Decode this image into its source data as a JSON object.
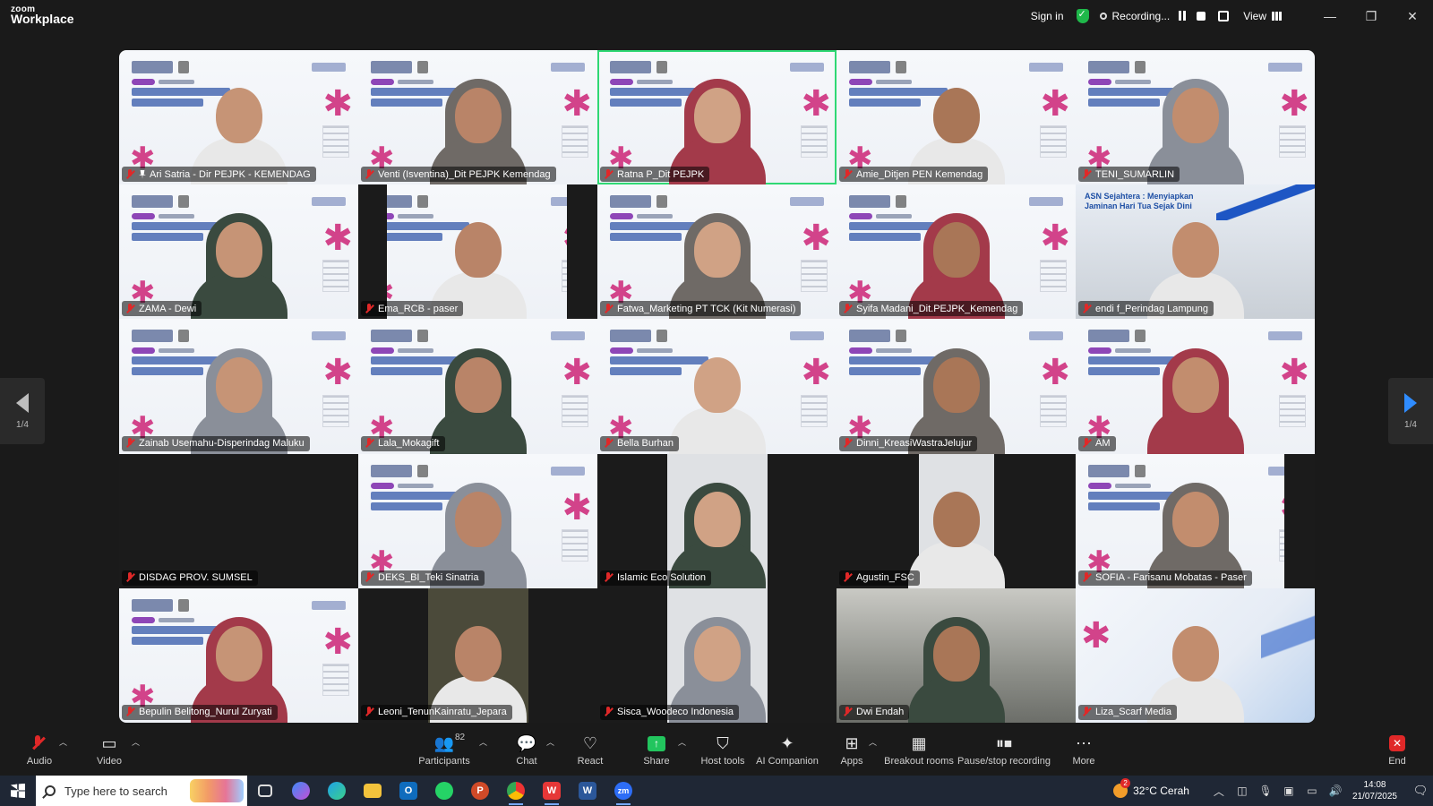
{
  "app": {
    "logo_line1": "zoom",
    "logo_line2": "Workplace"
  },
  "titlebar": {
    "sign_in": "Sign in",
    "recording_label": "Recording...",
    "view_label": "View",
    "window_controls": {
      "minimize": "—",
      "restore": "❐",
      "close": "✕"
    }
  },
  "pager": {
    "left_page": "1/4",
    "right_page": "1/4"
  },
  "participants": [
    {
      "name": "Ari Satria - Dir PEJPK - KEMENDAG",
      "bg": "banner",
      "pinned": true
    },
    {
      "name": "Venti (Isventina)_Dit PEJPK Kemendag",
      "bg": "banner"
    },
    {
      "name": "Ratna P_Dit PEJPK",
      "bg": "banner",
      "active": true
    },
    {
      "name": "Amie_Ditjen PEN Kemendag",
      "bg": "banner"
    },
    {
      "name": "TENI_SUMARLIN",
      "bg": "banner"
    },
    {
      "name": "ZAMA - Dewi",
      "bg": "banner"
    },
    {
      "name": "Ema_RCB - paser",
      "bg": "banner-letterbox"
    },
    {
      "name": "Fatwa_Marketing PT TCK (Kit Numerasi)",
      "bg": "banner"
    },
    {
      "name": "Syifa Madani_Dit.PEJPK_Kemendag",
      "bg": "banner"
    },
    {
      "name": "endi f_Perindag Lampung",
      "bg": "bkd",
      "banner_text": "ASN Sejahtera : Menyiapkan Jaminan Hari Tua Sejak Dini"
    },
    {
      "name": "Zainab Usemahu-Disperindag Maluku",
      "bg": "banner"
    },
    {
      "name": "Lala_Mokagift",
      "bg": "banner"
    },
    {
      "name": "Bella Burhan",
      "bg": "banner"
    },
    {
      "name": "Dinni_KreasiWastraJelujur",
      "bg": "banner"
    },
    {
      "name": "AM",
      "bg": "banner"
    },
    {
      "name": "DISDAG PROV. SUMSEL",
      "bg": "dark"
    },
    {
      "name": "DEKS_BI_Teki Sinatria",
      "bg": "banner"
    },
    {
      "name": "Islamic Eco Solution",
      "bg": "portrait"
    },
    {
      "name": "Agustin_FSC",
      "bg": "portrait-small"
    },
    {
      "name": "SOFIA - Farisanu Mobatas - Paser",
      "bg": "banner-letterbox-right"
    },
    {
      "name": "Bepulin Belitong_Nurul Zuryati",
      "bg": "banner"
    },
    {
      "name": "Leoni_TenunKainratu_Jepara",
      "bg": "portrait-green"
    },
    {
      "name": "Sisca_Woodeco Indonesia",
      "bg": "portrait"
    },
    {
      "name": "Dwi Endah",
      "bg": "room"
    },
    {
      "name": "Liza_Scarf Media",
      "bg": "blue"
    }
  ],
  "toolbar": {
    "audio": "Audio",
    "video": "Video",
    "participants": "Participants",
    "participants_count": "82",
    "chat": "Chat",
    "react": "React",
    "share": "Share",
    "host_tools": "Host tools",
    "ai_companion": "AI Companion",
    "apps": "Apps",
    "breakout_rooms": "Breakout rooms",
    "pause_stop_recording": "Pause/stop recording",
    "more": "More",
    "end": "End"
  },
  "taskbar": {
    "search_placeholder": "Type here to search",
    "weather": "32°C  Cerah",
    "time": "14:08",
    "date": "21/07/2025"
  },
  "colors": {
    "active_speaker": "#2fd874",
    "recording": "#ffffff",
    "share": "#22c55e",
    "end": "#e02828",
    "accent_pink": "#d2438a"
  }
}
